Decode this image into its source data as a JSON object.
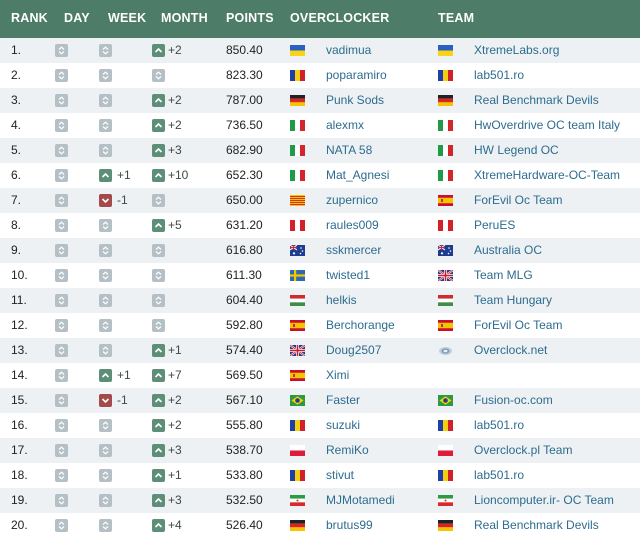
{
  "header": {
    "rank": "RANK",
    "day": "DAY",
    "week": "WEEK",
    "month": "MONTH",
    "points": "POINTS",
    "overclocker": "OVERCLOCKER",
    "team": "TEAM"
  },
  "colors": {
    "header_bg": "#4d7c69",
    "row_alt_bg": "#edf1f3",
    "link": "#2d6c8f",
    "neutral_box": "#b5c0c6",
    "up_box": "#5c8e78",
    "down_box": "#a54a4a"
  },
  "rows": [
    {
      "rank": "1.",
      "day": {
        "dir": "none",
        "val": ""
      },
      "week": {
        "dir": "none",
        "val": ""
      },
      "month": {
        "dir": "up",
        "val": "+2"
      },
      "points": "850.40",
      "name": "vadimua",
      "name_flag": "UA",
      "team": "XtremeLabs.org",
      "team_flag": "UA"
    },
    {
      "rank": "2.",
      "day": {
        "dir": "none",
        "val": ""
      },
      "week": {
        "dir": "none",
        "val": ""
      },
      "month": {
        "dir": "none",
        "val": ""
      },
      "points": "823.30",
      "name": "poparamiro",
      "name_flag": "RO",
      "team": "lab501.ro",
      "team_flag": "RO"
    },
    {
      "rank": "3.",
      "day": {
        "dir": "none",
        "val": ""
      },
      "week": {
        "dir": "none",
        "val": ""
      },
      "month": {
        "dir": "up",
        "val": "+2"
      },
      "points": "787.00",
      "name": "Punk Sods",
      "name_flag": "DE",
      "team": "Real Benchmark Devils",
      "team_flag": "DE"
    },
    {
      "rank": "4.",
      "day": {
        "dir": "none",
        "val": ""
      },
      "week": {
        "dir": "none",
        "val": ""
      },
      "month": {
        "dir": "up",
        "val": "+2"
      },
      "points": "736.50",
      "name": "alexmx",
      "name_flag": "IT",
      "team": "HwOverdrive OC team Italy",
      "team_flag": "IT"
    },
    {
      "rank": "5.",
      "day": {
        "dir": "none",
        "val": ""
      },
      "week": {
        "dir": "none",
        "val": ""
      },
      "month": {
        "dir": "up",
        "val": "+3"
      },
      "points": "682.90",
      "name": "NATA 58",
      "name_flag": "IT",
      "team": "HW Legend OC",
      "team_flag": "IT"
    },
    {
      "rank": "6.",
      "day": {
        "dir": "none",
        "val": ""
      },
      "week": {
        "dir": "up",
        "val": "+1"
      },
      "month": {
        "dir": "up",
        "val": "+10"
      },
      "points": "652.30",
      "name": "Mat_Agnesi",
      "name_flag": "IT",
      "team": "XtremeHardware-OC-Team",
      "team_flag": "IT"
    },
    {
      "rank": "7.",
      "day": {
        "dir": "none",
        "val": ""
      },
      "week": {
        "dir": "down",
        "val": "-1"
      },
      "month": {
        "dir": "none",
        "val": ""
      },
      "points": "650.00",
      "name": "zupernico",
      "name_flag": "CAT",
      "team": "ForEvil Oc Team",
      "team_flag": "ES"
    },
    {
      "rank": "8.",
      "day": {
        "dir": "none",
        "val": ""
      },
      "week": {
        "dir": "none",
        "val": ""
      },
      "month": {
        "dir": "up",
        "val": "+5"
      },
      "points": "631.20",
      "name": "raules009",
      "name_flag": "PE",
      "team": "PeruES",
      "team_flag": "PE"
    },
    {
      "rank": "9.",
      "day": {
        "dir": "none",
        "val": ""
      },
      "week": {
        "dir": "none",
        "val": ""
      },
      "month": {
        "dir": "none",
        "val": ""
      },
      "points": "616.80",
      "name": "sskmercer",
      "name_flag": "AU",
      "team": "Australia OC",
      "team_flag": "AU"
    },
    {
      "rank": "10.",
      "day": {
        "dir": "none",
        "val": ""
      },
      "week": {
        "dir": "none",
        "val": ""
      },
      "month": {
        "dir": "none",
        "val": ""
      },
      "points": "611.30",
      "name": "twisted1",
      "name_flag": "SE",
      "team": "Team MLG",
      "team_flag": "GB"
    },
    {
      "rank": "11.",
      "day": {
        "dir": "none",
        "val": ""
      },
      "week": {
        "dir": "none",
        "val": ""
      },
      "month": {
        "dir": "none",
        "val": ""
      },
      "points": "604.40",
      "name": "helkis",
      "name_flag": "HU",
      "team": "Team Hungary",
      "team_flag": "HU"
    },
    {
      "rank": "12.",
      "day": {
        "dir": "none",
        "val": ""
      },
      "week": {
        "dir": "none",
        "val": ""
      },
      "month": {
        "dir": "none",
        "val": ""
      },
      "points": "592.80",
      "name": "Berchorange",
      "name_flag": "ES",
      "team": "ForEvil Oc Team",
      "team_flag": "ES"
    },
    {
      "rank": "13.",
      "day": {
        "dir": "none",
        "val": ""
      },
      "week": {
        "dir": "none",
        "val": ""
      },
      "month": {
        "dir": "up",
        "val": "+1"
      },
      "points": "574.40",
      "name": "Doug2507",
      "name_flag": "GB",
      "team": "Overclock.net",
      "team_flag": "OCN"
    },
    {
      "rank": "14.",
      "day": {
        "dir": "none",
        "val": ""
      },
      "week": {
        "dir": "up",
        "val": "+1"
      },
      "month": {
        "dir": "up",
        "val": "+7"
      },
      "points": "569.50",
      "name": "Ximi",
      "name_flag": "ES",
      "team": "",
      "team_flag": ""
    },
    {
      "rank": "15.",
      "day": {
        "dir": "none",
        "val": ""
      },
      "week": {
        "dir": "down",
        "val": "-1"
      },
      "month": {
        "dir": "up",
        "val": "+2"
      },
      "points": "567.10",
      "name": "Faster",
      "name_flag": "BR",
      "team": "Fusion-oc.com",
      "team_flag": "BR"
    },
    {
      "rank": "16.",
      "day": {
        "dir": "none",
        "val": ""
      },
      "week": {
        "dir": "none",
        "val": ""
      },
      "month": {
        "dir": "up",
        "val": "+2"
      },
      "points": "555.80",
      "name": "suzuki",
      "name_flag": "RO",
      "team": "lab501.ro",
      "team_flag": "RO"
    },
    {
      "rank": "17.",
      "day": {
        "dir": "none",
        "val": ""
      },
      "week": {
        "dir": "none",
        "val": ""
      },
      "month": {
        "dir": "up",
        "val": "+3"
      },
      "points": "538.70",
      "name": "RemiKo",
      "name_flag": "PL",
      "team": "Overclock.pl Team",
      "team_flag": "PL"
    },
    {
      "rank": "18.",
      "day": {
        "dir": "none",
        "val": ""
      },
      "week": {
        "dir": "none",
        "val": ""
      },
      "month": {
        "dir": "up",
        "val": "+1"
      },
      "points": "533.80",
      "name": "stivut",
      "name_flag": "RO",
      "team": "lab501.ro",
      "team_flag": "RO"
    },
    {
      "rank": "19.",
      "day": {
        "dir": "none",
        "val": ""
      },
      "week": {
        "dir": "none",
        "val": ""
      },
      "month": {
        "dir": "up",
        "val": "+3"
      },
      "points": "532.50",
      "name": "MJMotamedi",
      "name_flag": "IR",
      "team": "Lioncomputer.ir- OC Team",
      "team_flag": "IR"
    },
    {
      "rank": "20.",
      "day": {
        "dir": "none",
        "val": ""
      },
      "week": {
        "dir": "none",
        "val": ""
      },
      "month": {
        "dir": "up",
        "val": "+4"
      },
      "points": "526.40",
      "name": "brutus99",
      "name_flag": "DE",
      "team": "Real Benchmark Devils",
      "team_flag": "DE"
    }
  ]
}
